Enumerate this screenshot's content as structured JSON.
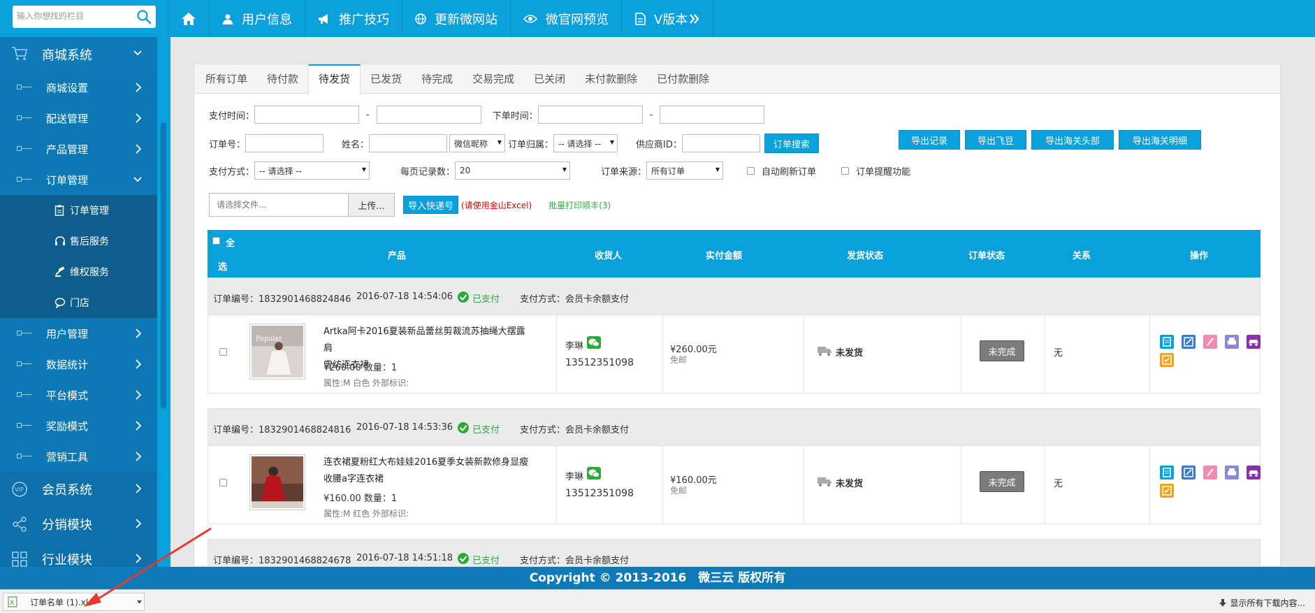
{
  "search": {
    "placeholder": "输入你想找的栏目"
  },
  "topnav": {
    "items": [
      {
        "label": ""
      },
      {
        "label": "用户信息"
      },
      {
        "label": "推广技巧"
      },
      {
        "label": "更新微网站"
      },
      {
        "label": "微官网预览"
      },
      {
        "label": "V版本"
      }
    ]
  },
  "sidebar": {
    "mall": "商城系统",
    "sub": [
      "商城设置",
      "配送管理",
      "产品管理",
      "订单管理"
    ],
    "children": [
      "订单管理",
      "售后服务",
      "维权服务",
      "门店"
    ],
    "sub2": [
      "用户管理",
      "数据统计",
      "平台模式",
      "奖励模式",
      "营销工具"
    ],
    "main2": [
      "会员系统",
      "分销模块",
      "行业模块"
    ]
  },
  "tabs": [
    "所有订单",
    "待付款",
    "待发货",
    "已发货",
    "待完成",
    "交易完成",
    "已关闭",
    "未付款删除",
    "已付款删除"
  ],
  "filters": {
    "pay_time": "支付时间：",
    "dash": "-",
    "order_time": "下单时间：",
    "order_no": "订单号：",
    "name": "姓名：",
    "nick_select": "微信昵称",
    "belong": "订单归属：",
    "belong_select": "-- 请选择 --",
    "supplier": "供应商ID：",
    "search_btn": "订单搜索",
    "export_record": "导出记录",
    "export_feidou": "导出飞豆",
    "export_customs_head": "导出海关头部",
    "export_customs_detail": "导出海关明细",
    "pay_method": "支付方式：",
    "pay_method_select": "-- 请选择 --",
    "per_page": "每页记录数：",
    "per_page_select": "20",
    "source": "订单来源：",
    "source_select": "所有订单",
    "auto_refresh": "自动刷新订单",
    "remind": "订单提醒功能",
    "file_placeholder": "请选择文件...",
    "upload_btn": "上传...",
    "import_btn": "导入快递号",
    "import_tip": "(请使用金山Excel)",
    "batch_print": "批量打印顺丰(3)"
  },
  "table": {
    "select_all_1": "全",
    "select_all_2": "选",
    "headers": [
      "产品",
      "收货人",
      "实付金额",
      "发货状态",
      "订单状态",
      "关系",
      "操作"
    ]
  },
  "orders": [
    {
      "no": "订单编号：1832901468824846",
      "time": "2016-07-18 14:54:06",
      "paid": "已支付",
      "pay_method": "支付方式：会员卡余额支付",
      "name_line1": "Artka阿卡2016夏装新品蕾丝剪裁流苏抽绳大摆露肩",
      "name_line2": "雪纺连衣裙",
      "price_qty": "¥260.00 数量：1",
      "attr": "属性:M 白色 外部标识:",
      "receiver": "李琳",
      "phone": "13512351098",
      "amount": "¥260.00元",
      "shipping_fee": "免邮",
      "ship_status": "未发货",
      "order_status": "未完成",
      "relation": "无"
    },
    {
      "no": "订单编号：1832901468824816",
      "time": "2016-07-18 14:53:36",
      "paid": "已支付",
      "pay_method": "支付方式：会员卡余额支付",
      "name_line1": "连衣裙夏粉红大布娃娃2016夏季女装新款修身显瘦",
      "name_line2": "收腰a字连衣裙",
      "price_qty": "¥160.00 数量：1",
      "attr": "属性:M 红色 外部标识:",
      "receiver": "李琳",
      "phone": "13512351098",
      "amount": "¥160.00元",
      "shipping_fee": "免邮",
      "ship_status": "未发货",
      "order_status": "未完成",
      "relation": "无"
    },
    {
      "no": "订单编号：1832901468824678",
      "time": "2016-07-18 14:51:18",
      "paid": "已支付",
      "pay_method": "支付方式：会员卡余额支付"
    }
  ],
  "footer": "Copyright © 2013-2016　微三云 版权所有",
  "download": {
    "file": "订单名单 (1).xls",
    "show_all": "显示所有下载内容..."
  },
  "colors": {
    "primary": "#0aa0dc",
    "sidebar": "#0f7ab8",
    "sidebar_dark": "#0e5d8c",
    "paid": "#2eaa3c",
    "warn": "#e00000",
    "batch": "#2eaa3c"
  }
}
